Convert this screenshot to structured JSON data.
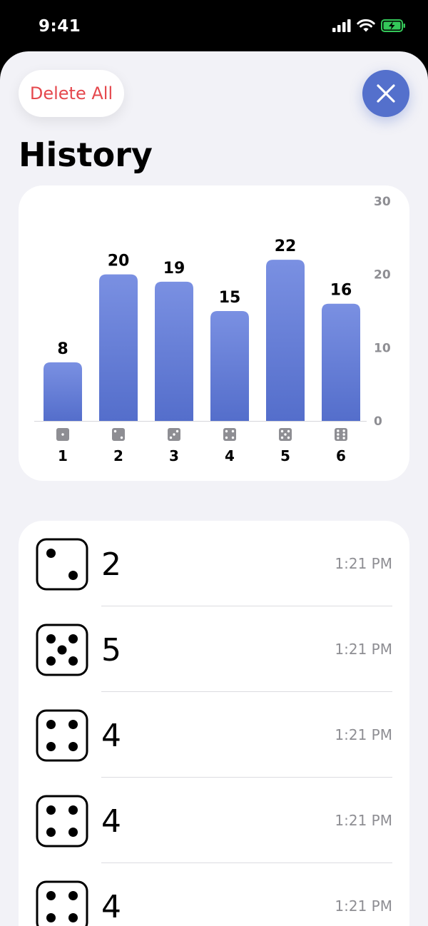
{
  "status": {
    "time": "9:41"
  },
  "header": {
    "delete_all_label": "Delete All",
    "title": "History"
  },
  "chart_data": {
    "type": "bar",
    "categories": [
      "1",
      "2",
      "3",
      "4",
      "5",
      "6"
    ],
    "values": [
      8,
      20,
      19,
      15,
      22,
      16
    ],
    "ylim": [
      0,
      30
    ],
    "yticks": [
      0,
      10,
      20,
      30
    ],
    "axis_side": "right",
    "bar_color": "#5e78d6",
    "tick_icons": [
      "die-face-1-icon",
      "die-face-2-icon",
      "die-face-3-icon",
      "die-face-4-icon",
      "die-face-5-icon",
      "die-face-6-icon"
    ]
  },
  "history": [
    {
      "value": "2",
      "time": "1:21 PM",
      "icon": "die-face-2-icon"
    },
    {
      "value": "5",
      "time": "1:21 PM",
      "icon": "die-face-5-icon"
    },
    {
      "value": "4",
      "time": "1:21 PM",
      "icon": "die-face-4-icon"
    },
    {
      "value": "4",
      "time": "1:21 PM",
      "icon": "die-face-4-icon"
    },
    {
      "value": "4",
      "time": "1:21 PM",
      "icon": "die-face-4-icon"
    }
  ],
  "colors": {
    "accent": "#5470cc",
    "danger": "#e5484d",
    "background": "#f2f2f7",
    "battery": "#34c759"
  }
}
